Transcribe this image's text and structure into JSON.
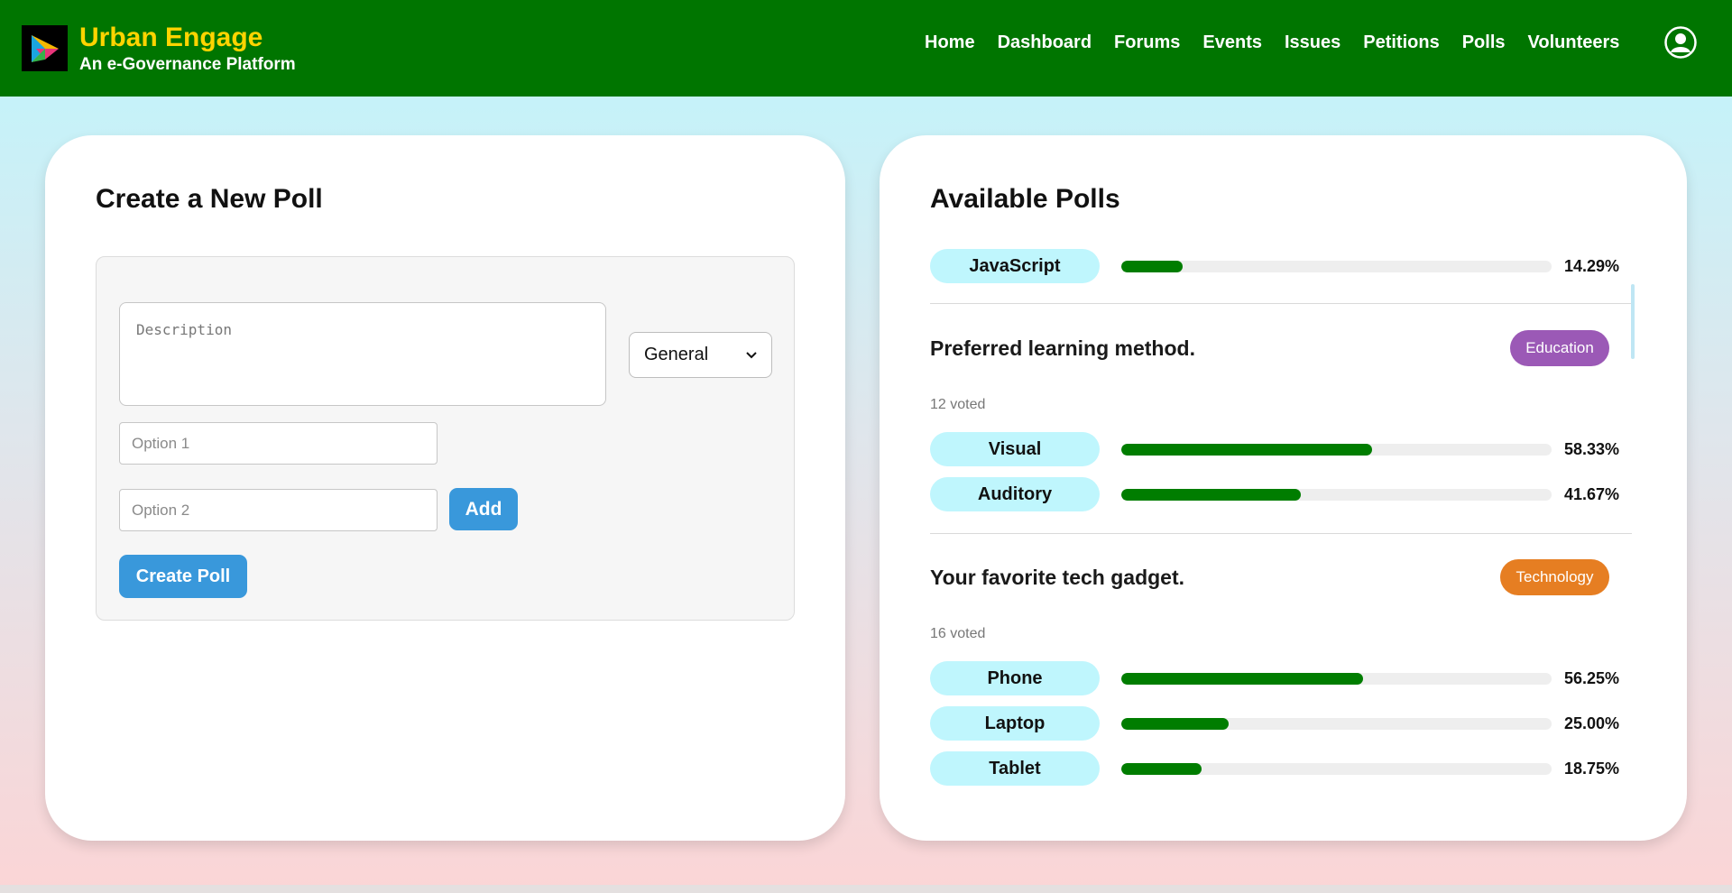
{
  "brand": {
    "title": "Urban Engage",
    "subtitle": "An e-Governance Platform",
    "logo_icon": "play-triangle-logo-icon",
    "title_color": "#ffd400"
  },
  "nav": {
    "items": [
      "Home",
      "Dashboard",
      "Forums",
      "Events",
      "Issues",
      "Petitions",
      "Polls",
      "Volunteers"
    ],
    "profile_icon": "user-circle-icon",
    "background": "#007500"
  },
  "create_poll": {
    "title": "Create a New Poll",
    "description_placeholder": "Description",
    "category_selected": "General",
    "option1_placeholder": "Option 1",
    "option2_placeholder": "Option 2",
    "add_label": "Add",
    "create_label": "Create Poll",
    "button_color": "#3998db"
  },
  "available_polls": {
    "title": "Available Polls",
    "partial_poll": {
      "options": [
        {
          "label": "JavaScript",
          "percent": 14.29,
          "percent_text": "14.29%"
        }
      ]
    },
    "polls": [
      {
        "question": "Preferred learning method.",
        "category": "Education",
        "category_color": "#9b59b6",
        "voted_text": "12 voted",
        "options": [
          {
            "label": "Visual",
            "percent": 58.33,
            "percent_text": "58.33%"
          },
          {
            "label": "Auditory",
            "percent": 41.67,
            "percent_text": "41.67%"
          }
        ]
      },
      {
        "question": "Your favorite tech gadget.",
        "category": "Technology",
        "category_color": "#e67e22",
        "voted_text": "16 voted",
        "options": [
          {
            "label": "Phone",
            "percent": 56.25,
            "percent_text": "56.25%"
          },
          {
            "label": "Laptop",
            "percent": 25.0,
            "percent_text": "25.00%"
          },
          {
            "label": "Tablet",
            "percent": 18.75,
            "percent_text": "18.75%"
          }
        ]
      }
    ],
    "bar_color": "#007d00"
  }
}
